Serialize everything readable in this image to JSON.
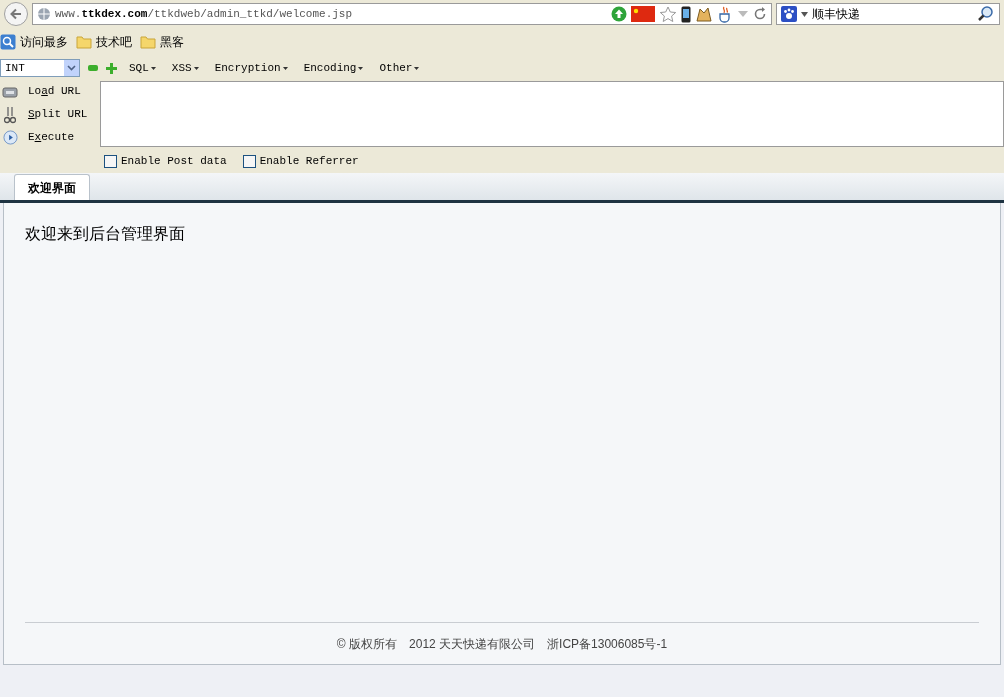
{
  "address_bar": {
    "url_prefix": "www.",
    "url_domain": "ttkdex.com",
    "url_path": "/ttkdweb/admin_ttkd/welcome.jsp"
  },
  "search": {
    "value": "顺丰快递"
  },
  "bookmarks": [
    {
      "label": "访问最多",
      "kind": "smart"
    },
    {
      "label": "技术吧",
      "kind": "folder"
    },
    {
      "label": "黑客",
      "kind": "folder"
    }
  ],
  "hackbar": {
    "type_select": "INT",
    "menus": [
      "SQL",
      "XSS",
      "Encryption",
      "Encoding",
      "Other"
    ],
    "actions": [
      {
        "before": "Lo",
        "key": "a",
        "after": "d URL",
        "kind": "load"
      },
      {
        "key": "S",
        "after": "plit URL",
        "kind": "split"
      },
      {
        "before": "E",
        "key": "x",
        "after": "ecute",
        "kind": "execute"
      }
    ],
    "options": [
      {
        "label": "Enable Post data",
        "checked": false
      },
      {
        "label": "Enable Referrer",
        "checked": false
      }
    ]
  },
  "tabs": [
    {
      "label": "欢迎界面",
      "selected": true
    }
  ],
  "content": {
    "heading": "欢迎来到后台管理界面"
  },
  "footer": {
    "copyright": "© 版权所有",
    "company": "2012 天天快递有限公司",
    "icp": "浙ICP备13006085号-1"
  }
}
